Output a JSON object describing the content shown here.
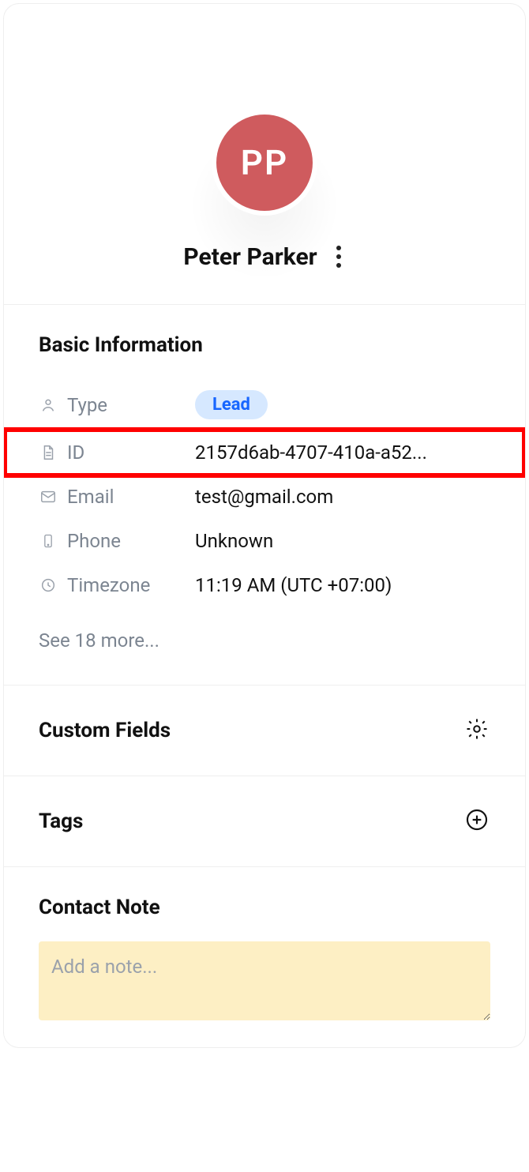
{
  "profile": {
    "initials": "PP",
    "name": "Peter Parker"
  },
  "basicInfo": {
    "title": "Basic Information",
    "type_label": "Type",
    "type_badge": "Lead",
    "id_label": "ID",
    "id_value": "2157d6ab-4707-410a-a52...",
    "email_label": "Email",
    "email_value": "test@gmail.com",
    "phone_label": "Phone",
    "phone_value": "Unknown",
    "tz_label": "Timezone",
    "tz_value": "11:19 AM (UTC +07:00)",
    "see_more": "See 18 more..."
  },
  "customFields": {
    "title": "Custom Fields"
  },
  "tags": {
    "title": "Tags"
  },
  "contactNote": {
    "title": "Contact Note",
    "placeholder": "Add a note..."
  }
}
